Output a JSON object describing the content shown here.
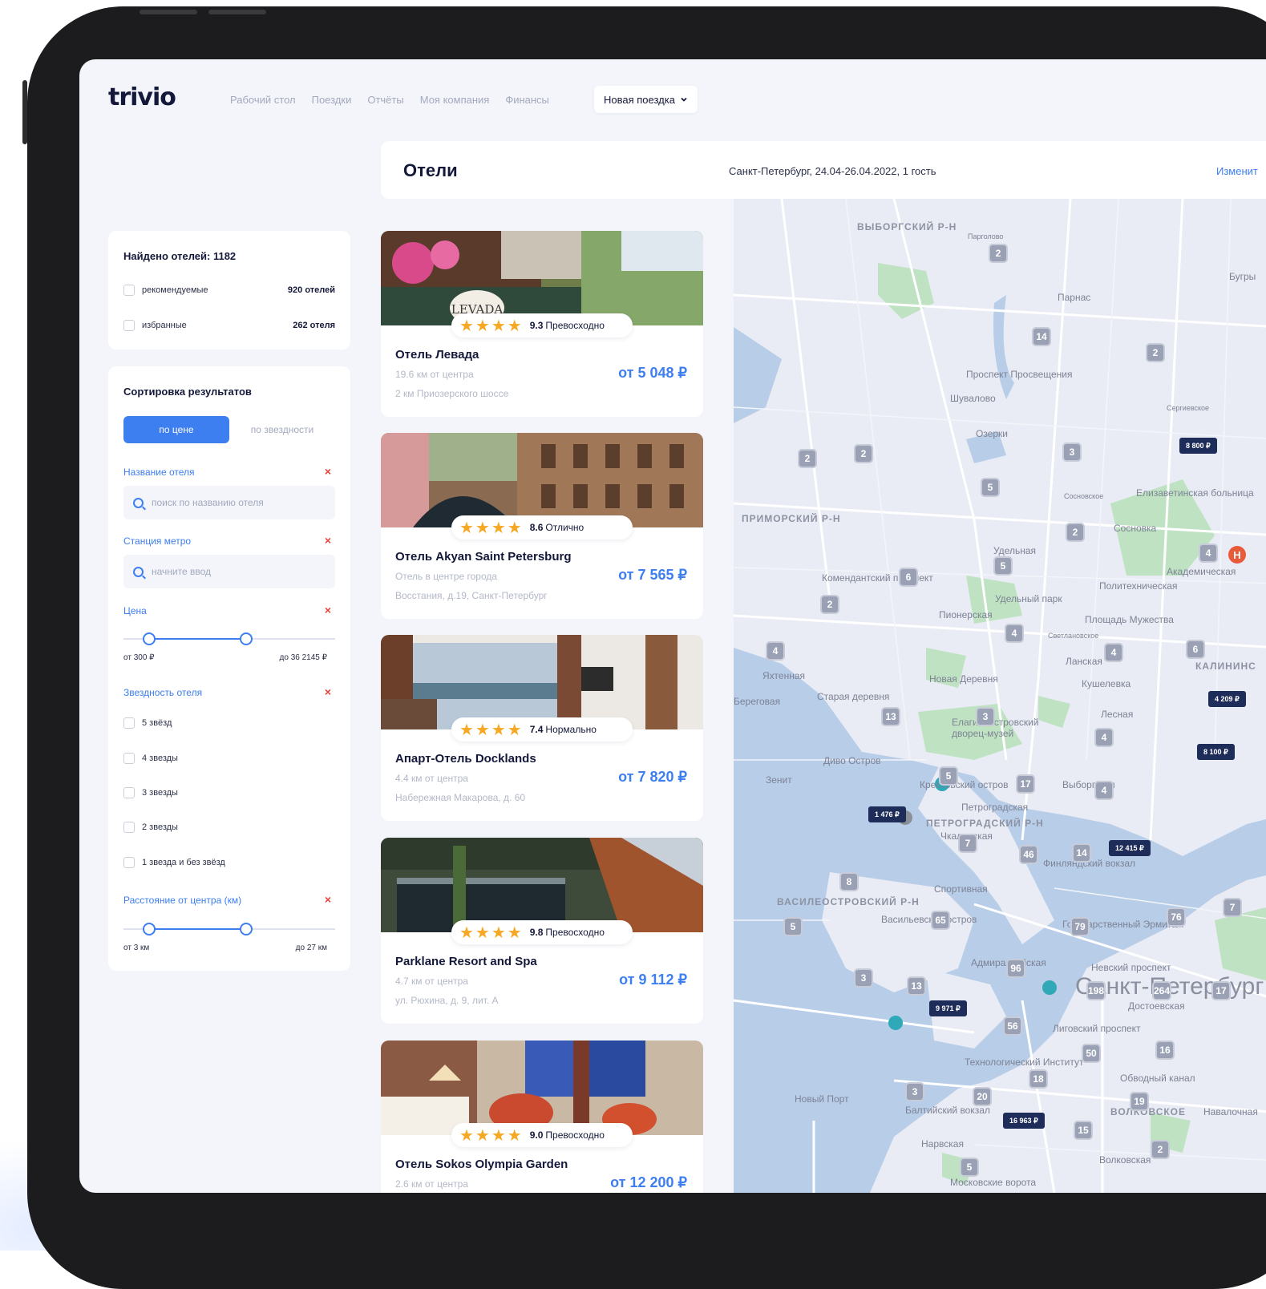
{
  "app": {
    "logo": "trivio"
  },
  "nav": {
    "items": [
      "Рабочий стол",
      "Поездки",
      "Отчёты",
      "Моя компания",
      "Финансы"
    ],
    "new_trip": "Новая поездка"
  },
  "header": {
    "title": "Отели",
    "search_summary": "Санкт-Петербург, 24.04-26.04.2022, 1 гость",
    "change": "Изменит"
  },
  "found": {
    "title": "Найдено отелей: 1182",
    "options": [
      {
        "label": "рекомендуемые",
        "count": "920 отелей"
      },
      {
        "label": "избранные",
        "count": "262 отеля"
      }
    ]
  },
  "sort": {
    "title": "Сортировка результатов",
    "by_price": "по цене",
    "by_stars": "по звездности",
    "hotel_name": {
      "label": "Название отеля",
      "placeholder": "поиск по названию отеля"
    },
    "metro": {
      "label": "Станция метро",
      "placeholder": "начните ввод"
    },
    "price": {
      "label": "Цена",
      "from": "от 300 ₽",
      "to": "до 36 2145 ₽",
      "low_fraction": 0.12,
      "high_fraction": 0.58
    },
    "stars": {
      "label": "Звездность отеля",
      "options": [
        "5 звёзд",
        "4 звезды",
        "3 звезды",
        "2 звезды",
        "1 звезда и без звёзд"
      ]
    },
    "distance": {
      "label": "Расстояние от центра (км)",
      "from": "от 3 км",
      "to": "до 27 км",
      "low_fraction": 0.12,
      "high_fraction": 0.58
    },
    "clear_icon": "close-icon"
  },
  "hotels": [
    {
      "name": "Отель Левада",
      "score": "9.3",
      "verdict": "Превосходно",
      "line1": "19.6 км от центра",
      "line2": "2 км Приозерского шоссе",
      "price": "от 5 048 ₽",
      "stars": 4,
      "sign": "LEVADA"
    },
    {
      "name": "Отель Akyan Saint Petersburg",
      "score": "8.6",
      "verdict": "Отлично",
      "line1": "Отель в центре города",
      "line2": "Восстания, д.19, Санкт-Петербург",
      "price": "от 7 565 ₽",
      "stars": 4
    },
    {
      "name": "Апарт-Отель Docklands",
      "score": "7.4",
      "verdict": "Нормально",
      "line1": "4.4 км от центра",
      "line2": "Набережная Макарова, д. 60",
      "price": "от 7 820 ₽",
      "stars": 4
    },
    {
      "name": "Parklane Resort and Spa",
      "score": "9.8",
      "verdict": "Превосходно",
      "line1": "4.7 км от центра",
      "line2": "ул. Рюхина, д. 9, лит. А",
      "price": "от 9 112 ₽",
      "stars": 4
    },
    {
      "name": "Отель Sokos Olympia Garden",
      "score": "9.0",
      "verdict": "Превосходно",
      "line1": "2.6 км от центра",
      "line2": "",
      "price": "от 12 200 ₽",
      "stars": 4
    }
  ],
  "map": {
    "districts": [
      "ВЫБОРГСКИЙ Р-Н",
      "ПРИМОРСКИЙ Р-Н",
      "ПЕТРОГРАДСКИЙ Р-Н",
      "ВАСИЛЕОСТРОВСКИЙ Р-Н",
      "КАЛИНИНС",
      "ВОЛКОВСКОЕ"
    ],
    "city": "Санкт-Петербург",
    "places": [
      "Парголово",
      "Парнас",
      "Проспект Просвещения",
      "Шувалово",
      "Озерки",
      "Сосновское",
      "Елизаветинская больница",
      "Сосновка",
      "Удельная",
      "Удельный парк",
      "Пионерская",
      "Комендантский проспект",
      "Академическая",
      "Политехническая",
      "Площадь Мужества",
      "Ланская",
      "Кушелевка",
      "Новая Деревня",
      "Старая деревня",
      "Яхтенная",
      "Лесная",
      "Елагиноостровский дворец-музей",
      "Диво Остров",
      "Крестовский остров",
      "Выборгская",
      "Петроградская",
      "Чкаловская",
      "Финляндский вокзал",
      "Спортивная",
      "Васильевский остров",
      "Государственный Эрмитаж",
      "Адмиралтейская",
      "Невский проспект",
      "Достоевская",
      "Лиговский проспект",
      "Технологический Институт",
      "Обводный канал",
      "Балтийский вокзал",
      "Нарвская",
      "Новый Порт",
      "Волковская",
      "Московские ворота",
      "Навалочная",
      "Бугры",
      "Зенит",
      "Береговая",
      "Сергиевское",
      "Светлановское"
    ],
    "clusters": [
      "2",
      "14",
      "2",
      "2",
      "2",
      "5",
      "3",
      "2",
      "4",
      "5",
      "6",
      "2",
      "4",
      "6",
      "4",
      "4",
      "13",
      "3",
      "4",
      "5",
      "17",
      "4",
      "7",
      "46",
      "14",
      "8",
      "5",
      "65",
      "79",
      "76",
      "7",
      "3",
      "13",
      "96",
      "198",
      "264",
      "17",
      "56",
      "50",
      "16",
      "18",
      "20",
      "3",
      "19",
      "15",
      "5",
      "2"
    ],
    "prices": [
      "8 800 ₽",
      "4 209 ₽",
      "8 100 ₽",
      "1 476 ₽",
      "12 415 ₽",
      "9 971 ₽",
      "16 963 ₽"
    ]
  }
}
